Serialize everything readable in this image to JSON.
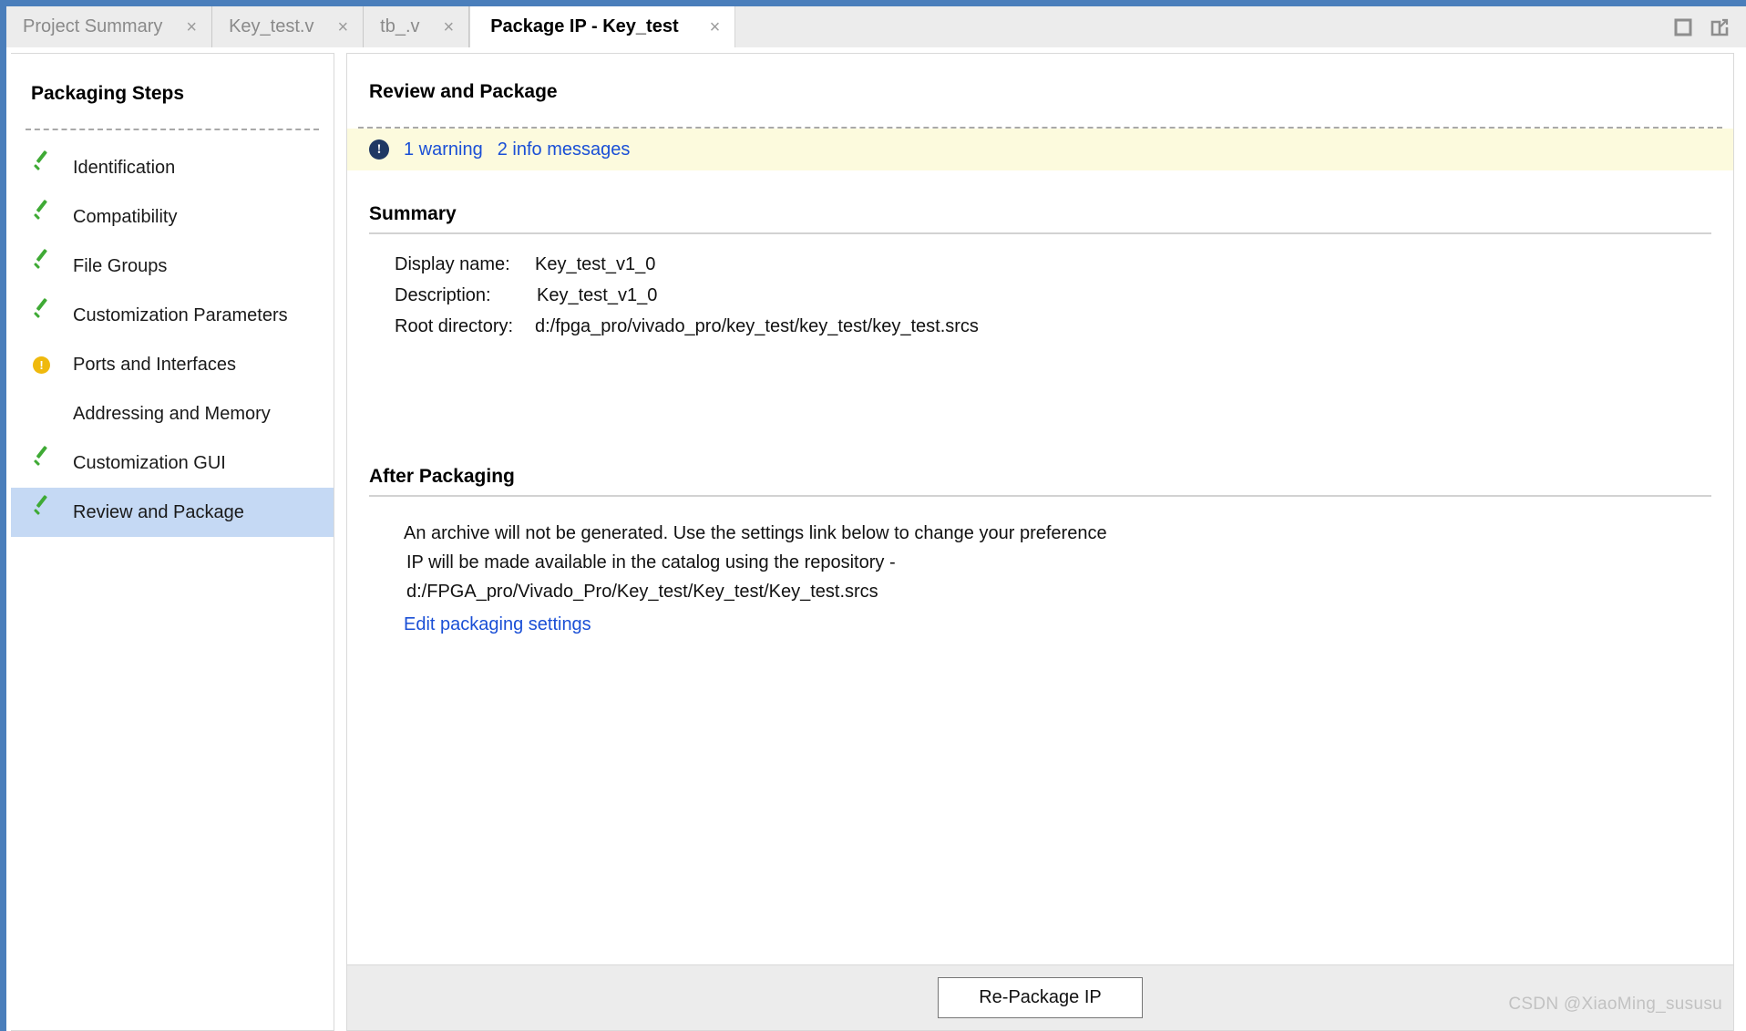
{
  "window": {
    "accent_color": "#4a7ebb",
    "controls": [
      {
        "name": "maximize-icon",
        "label": "maximize"
      },
      {
        "name": "float-window-icon",
        "label": "float"
      }
    ]
  },
  "tabs": [
    {
      "label": "Project Summary",
      "close": "×",
      "active": false
    },
    {
      "label": "Key_test.v",
      "close": "×",
      "active": false
    },
    {
      "label": "tb_.v",
      "close": "×",
      "active": false
    },
    {
      "label": "Package IP - Key_test",
      "close": "×",
      "active": true
    }
  ],
  "sidebar": {
    "title": "Packaging Steps",
    "items": [
      {
        "label": "Identification",
        "status": "done"
      },
      {
        "label": "Compatibility",
        "status": "done"
      },
      {
        "label": "File Groups",
        "status": "done"
      },
      {
        "label": "Customization Parameters",
        "status": "done"
      },
      {
        "label": "Ports and Interfaces",
        "status": "warning"
      },
      {
        "label": "Addressing and Memory",
        "status": "none"
      },
      {
        "label": "Customization GUI",
        "status": "done"
      },
      {
        "label": "Review and Package",
        "status": "done",
        "selected": true
      }
    ],
    "colors": {
      "check": "#3faa35",
      "warning": "#efb90d",
      "selected_bg": "#c5d9f4"
    }
  },
  "content": {
    "header": "Review and Package",
    "messages": {
      "icon": "info-icon",
      "warning_link": "1 warning",
      "info_link": "2 info messages",
      "background": "#fcfadd",
      "link_color": "#1a4fd6"
    },
    "summary": {
      "title": "Summary",
      "rows": [
        {
          "label": "Display name:",
          "value": "Key_test_v1_0"
        },
        {
          "label": "Description:",
          "value": "Key_test_v1_0"
        },
        {
          "label": "Root directory:",
          "value": "d:/fpga_pro/vivado_pro/key_test/key_test/key_test.srcs"
        }
      ]
    },
    "after_packaging": {
      "title": "After Packaging",
      "lines": [
        "An archive will not be generated. Use the settings link below to change your preference",
        "IP will be made available in the catalog using the repository -",
        "d:/FPGA_pro/Vivado_Pro/Key_test/Key_test/Key_test.srcs"
      ],
      "edit_link": "Edit packaging settings"
    }
  },
  "footer": {
    "repackage_button": "Re-Package IP"
  },
  "watermark": "CSDN @XiaoMing_sususu"
}
